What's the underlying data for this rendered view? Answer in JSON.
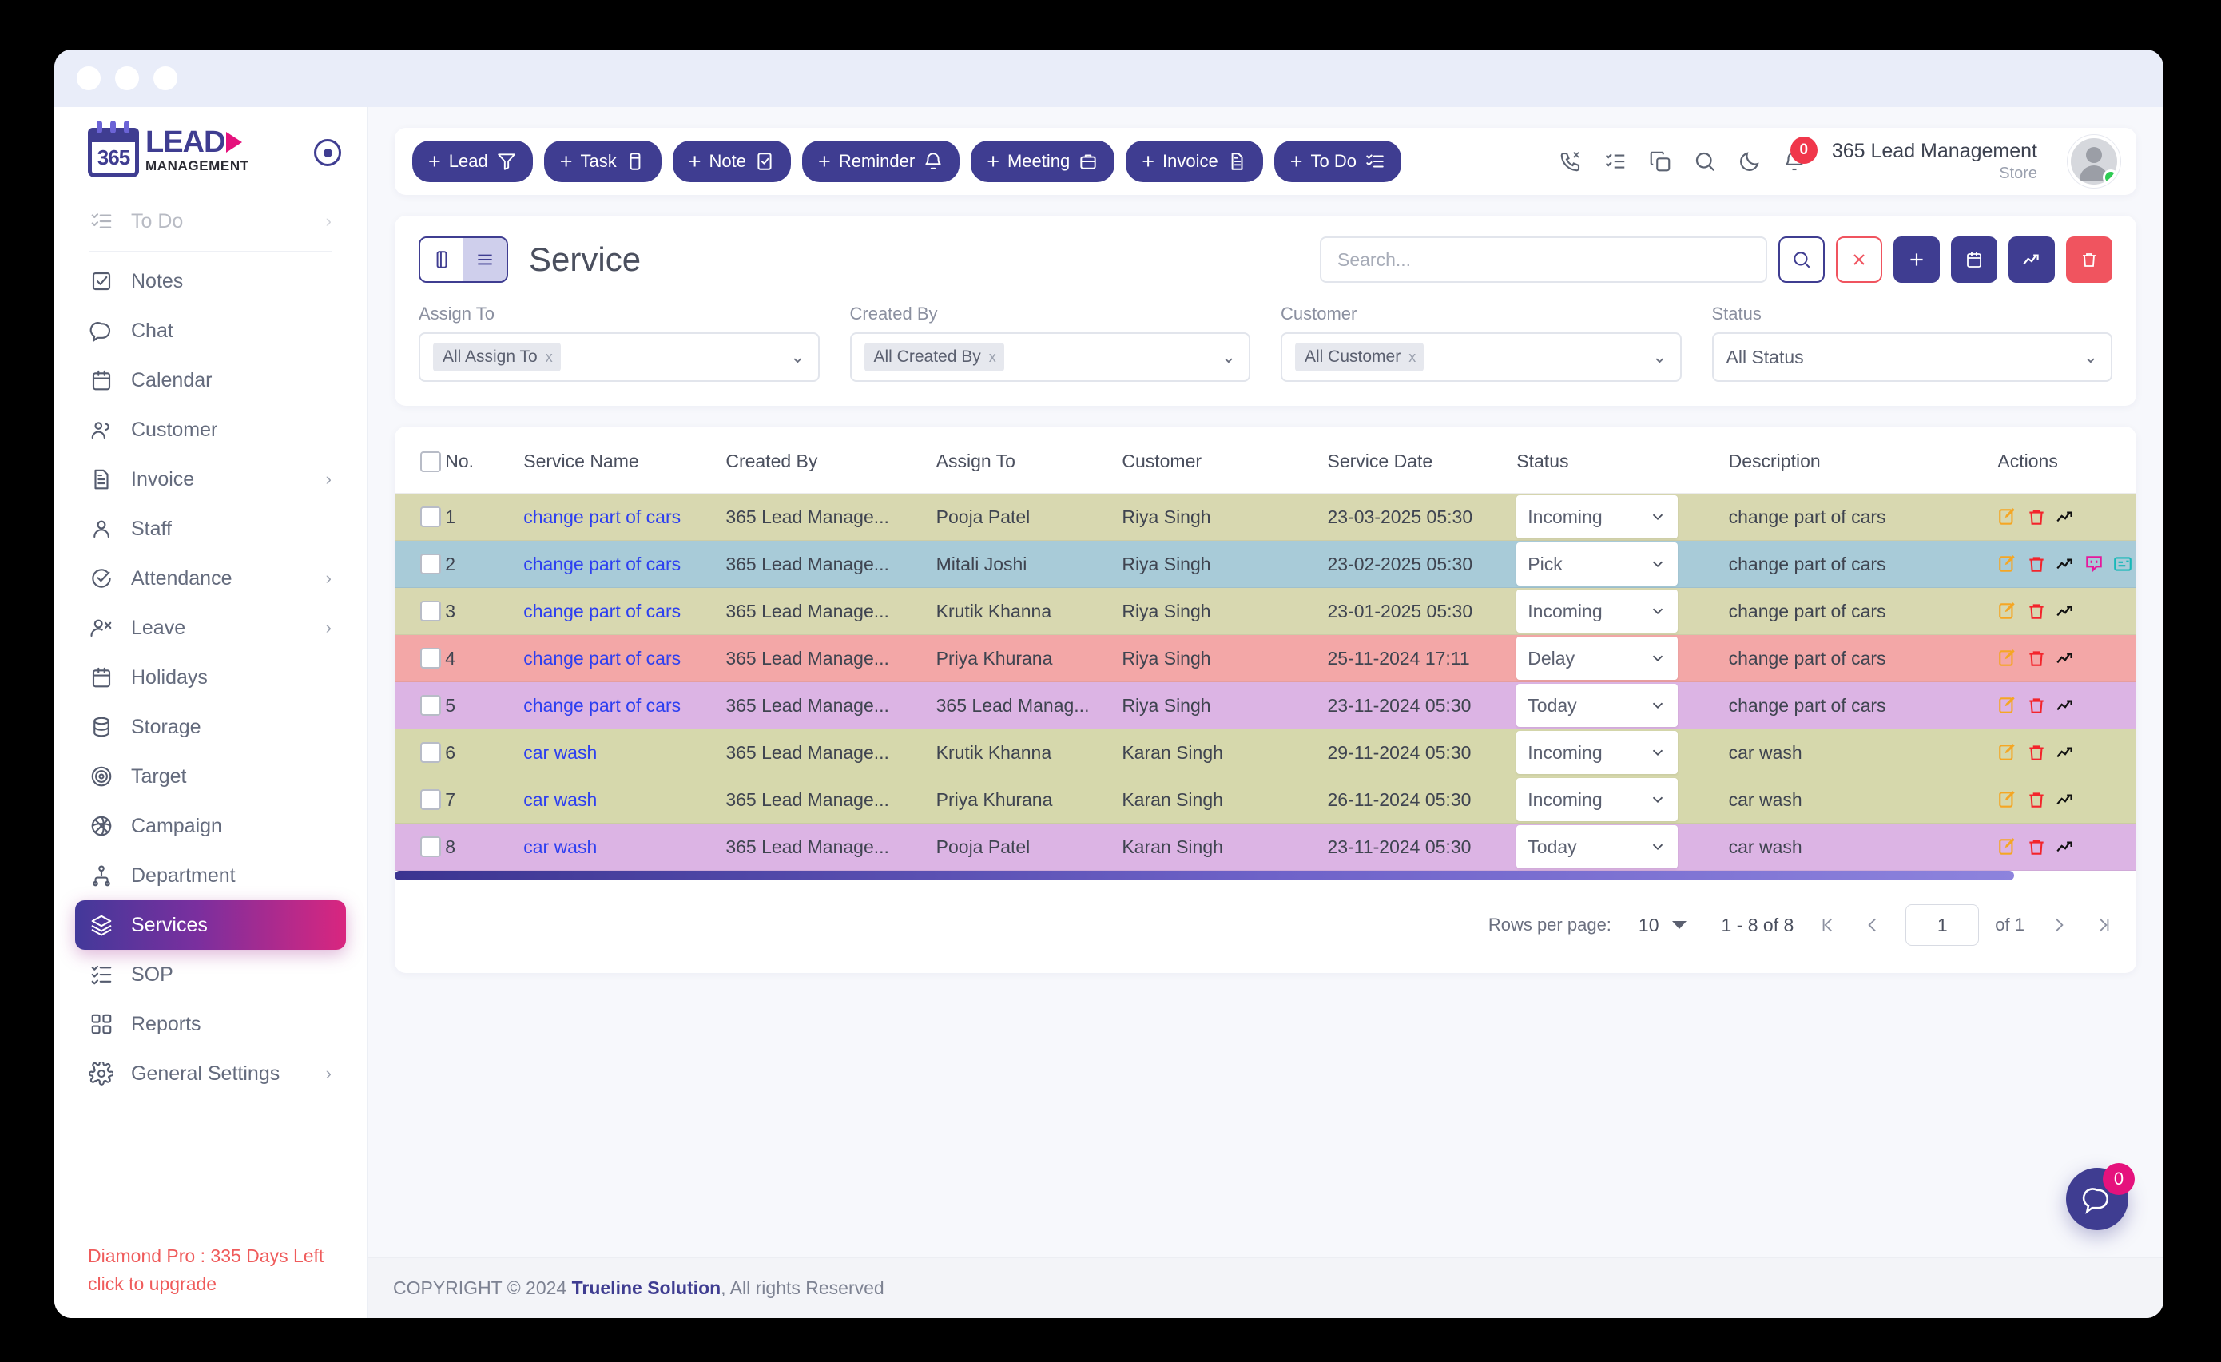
{
  "window": {
    "dots": 3
  },
  "brand": {
    "logo_365": "365",
    "logo_lead": "LEAD",
    "logo_mgmt": "MANAGEMENT"
  },
  "sidebar": {
    "items": [
      {
        "label": "To Do",
        "icon": "todo-icon",
        "chevron": "›",
        "faded": true
      },
      {
        "label": "Notes",
        "icon": "notes-icon",
        "chevron": ""
      },
      {
        "label": "Chat",
        "icon": "chat-icon",
        "chevron": ""
      },
      {
        "label": "Calendar",
        "icon": "calendar-icon",
        "chevron": ""
      },
      {
        "label": "Customer",
        "icon": "customer-icon",
        "chevron": ""
      },
      {
        "label": "Invoice",
        "icon": "invoice-icon",
        "chevron": "›"
      },
      {
        "label": "Staff",
        "icon": "staff-icon",
        "chevron": ""
      },
      {
        "label": "Attendance",
        "icon": "attendance-icon",
        "chevron": "›"
      },
      {
        "label": "Leave",
        "icon": "leave-icon",
        "chevron": "›"
      },
      {
        "label": "Holidays",
        "icon": "holidays-icon",
        "chevron": ""
      },
      {
        "label": "Storage",
        "icon": "storage-icon",
        "chevron": ""
      },
      {
        "label": "Target",
        "icon": "target-icon",
        "chevron": ""
      },
      {
        "label": "Campaign",
        "icon": "campaign-icon",
        "chevron": ""
      },
      {
        "label": "Department",
        "icon": "department-icon",
        "chevron": ""
      },
      {
        "label": "Services",
        "icon": "services-icon",
        "chevron": "",
        "active": true
      },
      {
        "label": "SOP",
        "icon": "sop-icon",
        "chevron": ""
      },
      {
        "label": "Reports",
        "icon": "reports-icon",
        "chevron": ""
      },
      {
        "label": "General Settings",
        "icon": "settings-icon",
        "chevron": "›"
      }
    ],
    "upgrade_line1": "Diamond Pro : 335 Days Left",
    "upgrade_line2": "click to upgrade",
    "upgrade_color": "#ef5b5b"
  },
  "topbar": {
    "quick_add": [
      {
        "label": "Lead",
        "icon": "funnel-icon"
      },
      {
        "label": "Task",
        "icon": "task-icon"
      },
      {
        "label": "Note",
        "icon": "note-check-icon"
      },
      {
        "label": "Reminder",
        "icon": "bell-icon"
      },
      {
        "label": "Meeting",
        "icon": "briefcase-icon"
      },
      {
        "label": "Invoice",
        "icon": "document-icon"
      },
      {
        "label": "To Do",
        "icon": "todo-list-icon"
      }
    ],
    "plus_symbol": "+",
    "icons": [
      {
        "name": "missed-call-icon"
      },
      {
        "name": "task-list-icon"
      },
      {
        "name": "copy-icon"
      },
      {
        "name": "search-icon"
      },
      {
        "name": "dark-mode-icon"
      },
      {
        "name": "notification-bell-icon",
        "badge": "0"
      }
    ],
    "account_name": "365 Lead Management",
    "account_role": "Store"
  },
  "panel": {
    "title": "Service",
    "view_grid_icon": "card-view-icon",
    "view_list_icon": "list-view-icon",
    "search": {
      "placeholder": "Search...",
      "value": ""
    },
    "actions": [
      {
        "name": "search-button",
        "glyph": "search-icon",
        "style": "outline-blue"
      },
      {
        "name": "clear-button",
        "glyph": "close-icon",
        "style": "outline-red"
      },
      {
        "name": "add-button",
        "glyph": "plus-icon",
        "style": "solid-blue"
      },
      {
        "name": "calendar-button",
        "glyph": "calendar-icon",
        "style": "solid-blue"
      },
      {
        "name": "trend-button",
        "glyph": "trend-icon",
        "style": "solid-blue"
      },
      {
        "name": "delete-button",
        "glyph": "trash-icon",
        "style": "solid-red"
      }
    ],
    "filters": [
      {
        "label": "Assign To",
        "value": "All Assign To",
        "type": "chip"
      },
      {
        "label": "Created By",
        "value": "All Created By",
        "type": "chip"
      },
      {
        "label": "Customer",
        "value": "All Customer",
        "type": "chip"
      },
      {
        "label": "Status",
        "value": "All Status",
        "type": "plain"
      }
    ],
    "chip_remove": "x"
  },
  "table": {
    "columns": [
      "No.",
      "Service Name",
      "Created By",
      "Assign To",
      "Customer",
      "Service Date",
      "Status",
      "Description",
      "Actions"
    ],
    "rows": [
      {
        "no": "1",
        "service_name": "change part of cars",
        "created_by": "365 Lead Manage...",
        "assign_to": "Pooja Patel",
        "customer": "Riya Singh",
        "service_date": "23-03-2025 05:30",
        "status": "Incoming",
        "description": "change part of cars",
        "row_color": "#d8d8b0",
        "extra_actions": false
      },
      {
        "no": "2",
        "service_name": "change part of cars",
        "created_by": "365 Lead Manage...",
        "assign_to": "Mitali Joshi",
        "customer": "Riya Singh",
        "service_date": "23-02-2025 05:30",
        "status": "Pick",
        "description": "change part of cars",
        "row_color": "#a8cbd8",
        "extra_actions": true
      },
      {
        "no": "3",
        "service_name": "change part of cars",
        "created_by": "365 Lead Manage...",
        "assign_to": "Krutik Khanna",
        "customer": "Riya Singh",
        "service_date": "23-01-2025 05:30",
        "status": "Incoming",
        "description": "change part of cars",
        "row_color": "#d8d8b0",
        "extra_actions": false
      },
      {
        "no": "4",
        "service_name": "change part of cars",
        "created_by": "365 Lead Manage...",
        "assign_to": "Priya Khurana",
        "customer": "Riya Singh",
        "service_date": "25-11-2024 17:11",
        "status": "Delay",
        "description": "change part of cars",
        "row_color": "#f3a7a7",
        "extra_actions": false
      },
      {
        "no": "5",
        "service_name": "change part of cars",
        "created_by": "365 Lead Manage...",
        "assign_to": "365 Lead Manag...",
        "customer": "Riya Singh",
        "service_date": "23-11-2024 05:30",
        "status": "Today",
        "description": "change part of cars",
        "row_color": "#dcb4e4",
        "extra_actions": false
      },
      {
        "no": "6",
        "service_name": "car wash",
        "created_by": "365 Lead Manage...",
        "assign_to": "Krutik Khanna",
        "customer": "Karan Singh",
        "service_date": "29-11-2024 05:30",
        "status": "Incoming",
        "description": "car wash",
        "row_color": "#d6d8ac",
        "extra_actions": false
      },
      {
        "no": "7",
        "service_name": "car wash",
        "created_by": "365 Lead Manage...",
        "assign_to": "Priya Khurana",
        "customer": "Karan Singh",
        "service_date": "26-11-2024 05:30",
        "status": "Incoming",
        "description": "car wash",
        "row_color": "#d6d8ac",
        "extra_actions": false
      },
      {
        "no": "8",
        "service_name": "car wash",
        "created_by": "365 Lead Manage...",
        "assign_to": "Pooja Patel",
        "customer": "Karan Singh",
        "service_date": "23-11-2024 05:30",
        "status": "Today",
        "description": "car wash",
        "row_color": "#dcb4e4",
        "extra_actions": false
      }
    ],
    "row_action_icons": [
      "edit-icon",
      "delete-icon",
      "trend-icon"
    ],
    "row_extra_icons": [
      "chat-bubble-icon",
      "card-icon"
    ]
  },
  "paginator": {
    "rows_per_page_label": "Rows per page:",
    "rows_per_page_value": "10",
    "range": "1 - 8 of 8",
    "first_icon": "first-page-icon",
    "prev_icon": "prev-page-icon",
    "page_value": "1",
    "of_label": "of 1",
    "next_icon": "next-page-icon",
    "last_icon": "last-page-icon"
  },
  "footer": {
    "copyright_prefix": "COPYRIGHT © 2024 ",
    "company": "Trueline Solution",
    "copyright_suffix": ", All rights Reserved"
  },
  "chat_widget": {
    "badge": "0",
    "icon": "chat-bubble-icon"
  }
}
